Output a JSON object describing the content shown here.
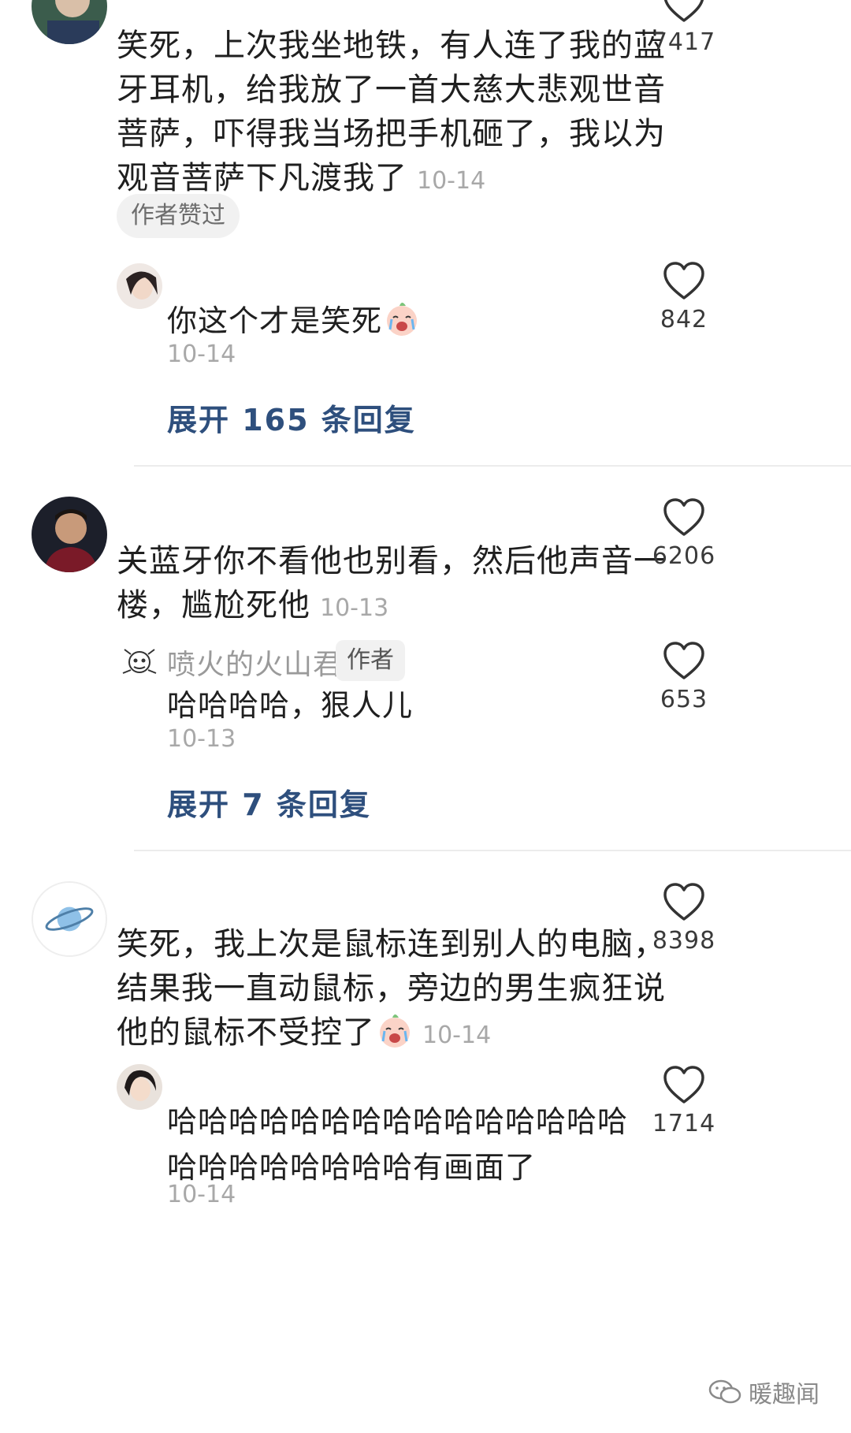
{
  "comments": [
    {
      "text": "笑死，上次我坐地铁，有人连了我的蓝牙耳机，给我放了一首大慈大悲观世音菩萨，吓得我当场把手机砸了，我以为观音菩萨下凡渡我了",
      "date": "10-14",
      "likes": "7417",
      "tag": "作者赞过",
      "reply": {
        "text": "你这个才是笑死",
        "date": "10-14",
        "likes": "842"
      },
      "expand": "展开 165 条回复"
    },
    {
      "text": "关蓝牙你不看他也别看，然后他声音一楼，尴尬死他",
      "date": "10-13",
      "likes": "6206",
      "reply": {
        "name": "喷火的火山君",
        "badge": "作者",
        "text": "哈哈哈哈，狠人儿",
        "date": "10-13",
        "likes": "653"
      },
      "expand": "展开 7 条回复"
    },
    {
      "text": "笑死，我上次是鼠标连到别人的电脑，结果我一直动鼠标，旁边的男生疯狂说他的鼠标不受控了",
      "date": "10-14",
      "likes": "8398",
      "reply": {
        "text": "哈哈哈哈哈哈哈哈哈哈哈哈哈哈哈哈哈哈哈哈哈哈哈有画面了",
        "date": "10-14",
        "likes": "1714"
      }
    }
  ],
  "watermark": "暖趣闻",
  "colors": {
    "link": "#2e4f7d",
    "muted": "#a8a8a8",
    "pill_bg": "#f1f1f1"
  },
  "icons": {
    "like": "heart-outline-icon",
    "emoji": "crying-emoji-icon",
    "watermark": "wechat-icon"
  }
}
